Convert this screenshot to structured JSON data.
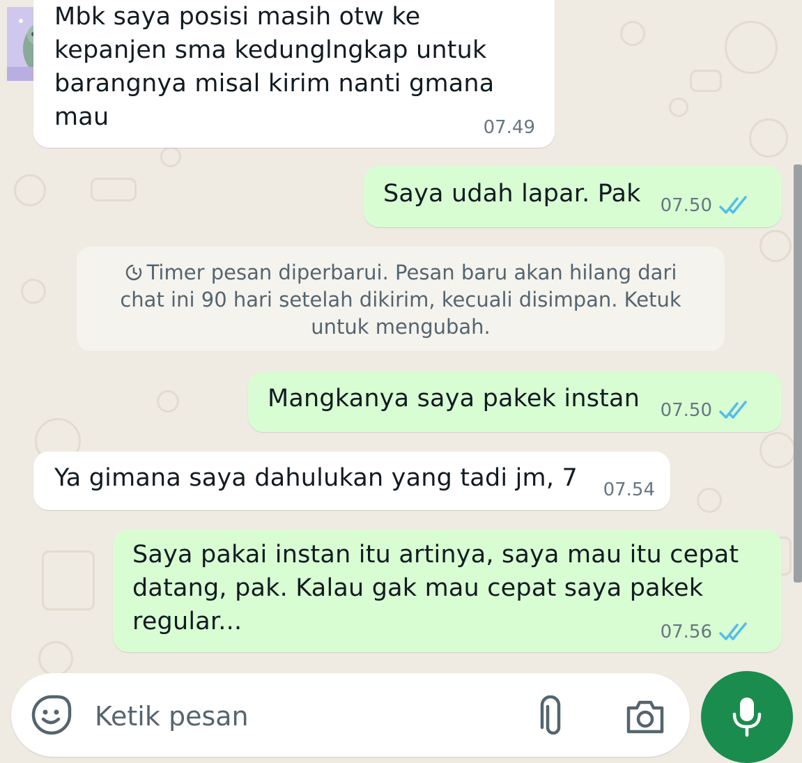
{
  "messages": [
    {
      "direction": "incoming",
      "text": "Mbk saya posisi masih otw ke kepanjen sma kedunglngkap untuk barangnya misal kirim nanti gmana mau",
      "time": "07.49"
    },
    {
      "direction": "outgoing",
      "text": "Saya udah lapar. Pak",
      "time": "07.50",
      "status": "read"
    },
    {
      "direction": "outgoing",
      "text": "Mangkanya saya pakek instan",
      "time": "07.50",
      "status": "read"
    },
    {
      "direction": "incoming",
      "text": "Ya gimana saya dahulukan yang tadi jm, 7",
      "time": "07.54"
    },
    {
      "direction": "outgoing",
      "text": "Saya pakai instan itu artinya, saya mau itu cepat datang, pak. Kalau gak mau cepat saya pakek regular...",
      "time": "07.56",
      "status": "read"
    }
  ],
  "system_notice": {
    "icon": "timer-icon",
    "text": "Timer pesan diperbarui. Pesan baru akan hilang dari chat ini 90 hari setelah dikirim, kecuali disimpan. Ketuk untuk mengubah."
  },
  "composer": {
    "placeholder": "Ketik pesan",
    "icons": [
      "sticker-icon",
      "attach-icon",
      "camera-icon",
      "mic-icon"
    ]
  },
  "colors": {
    "background": "#efeae2",
    "incoming_bubble": "#ffffff",
    "outgoing_bubble": "#d9fdd3",
    "read_ticks": "#53bdeb",
    "mic_button": "#1a8c4e"
  }
}
